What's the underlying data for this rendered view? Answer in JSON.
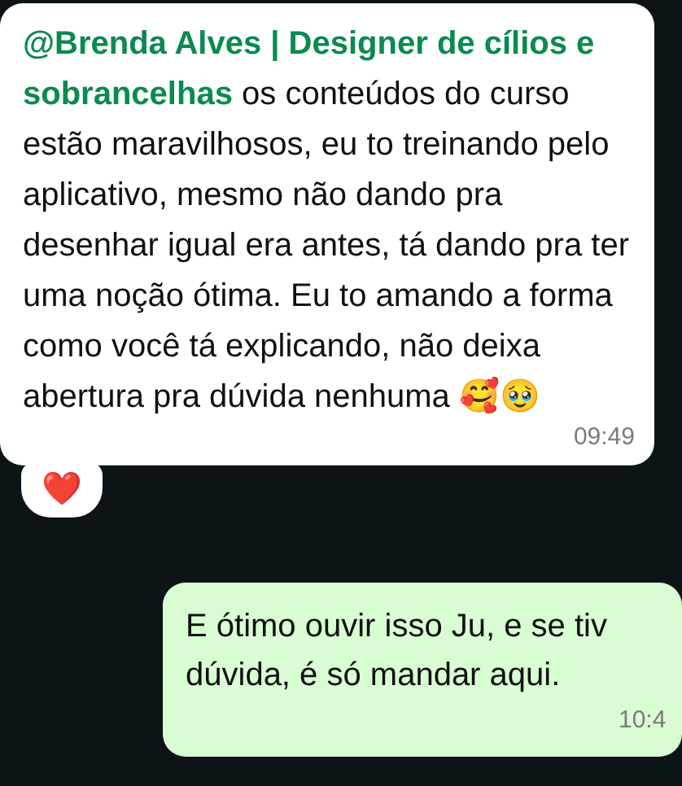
{
  "messages": [
    {
      "kind": "incoming",
      "mention": "@Brenda Alves | Designer de cílios e sobrancelhas",
      "text": " os conteúdos do curso estão maravilhosos, eu to treinando pelo aplicativo, mesmo não dando pra desenhar igual era antes, tá dando pra ter uma noção ótima. Eu to amando a forma como você tá explicando, não deixa abertura pra dúvida nenhuma 🥰🥹",
      "time": "09:49",
      "reaction": "❤️"
    },
    {
      "kind": "outgoing",
      "lines": [
        "E ótimo ouvir isso Ju, e se tiv",
        "dúvida, é só mandar aqui."
      ],
      "time": "10:4"
    }
  ]
}
